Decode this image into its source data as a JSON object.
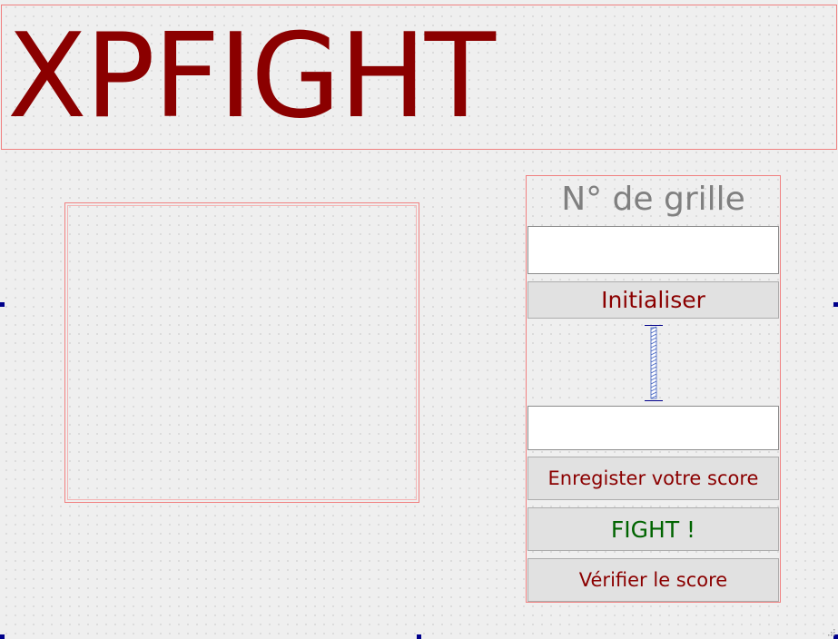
{
  "header": {
    "title": "XPFIGHT"
  },
  "panel": {
    "grid_label": "N° de grille",
    "grid_input_value": "",
    "init_button_label": "Initialiser",
    "score_input_value": "",
    "save_score_button_label": "Enregister votre score",
    "fight_button_label": "FIGHT !",
    "verify_score_button_label": "Vérifier le score"
  },
  "colors": {
    "title": "#8b0000",
    "button_text": "#8b0000",
    "fight_text": "#006400",
    "label_text": "#808080",
    "frame_border": "#f08080",
    "selection_handle": "#00008b"
  },
  "icons": {
    "spacer": "vertical-spacer-icon",
    "selection_handle": "selection-handle-icon",
    "resize_grip": "resize-grip-icon"
  }
}
